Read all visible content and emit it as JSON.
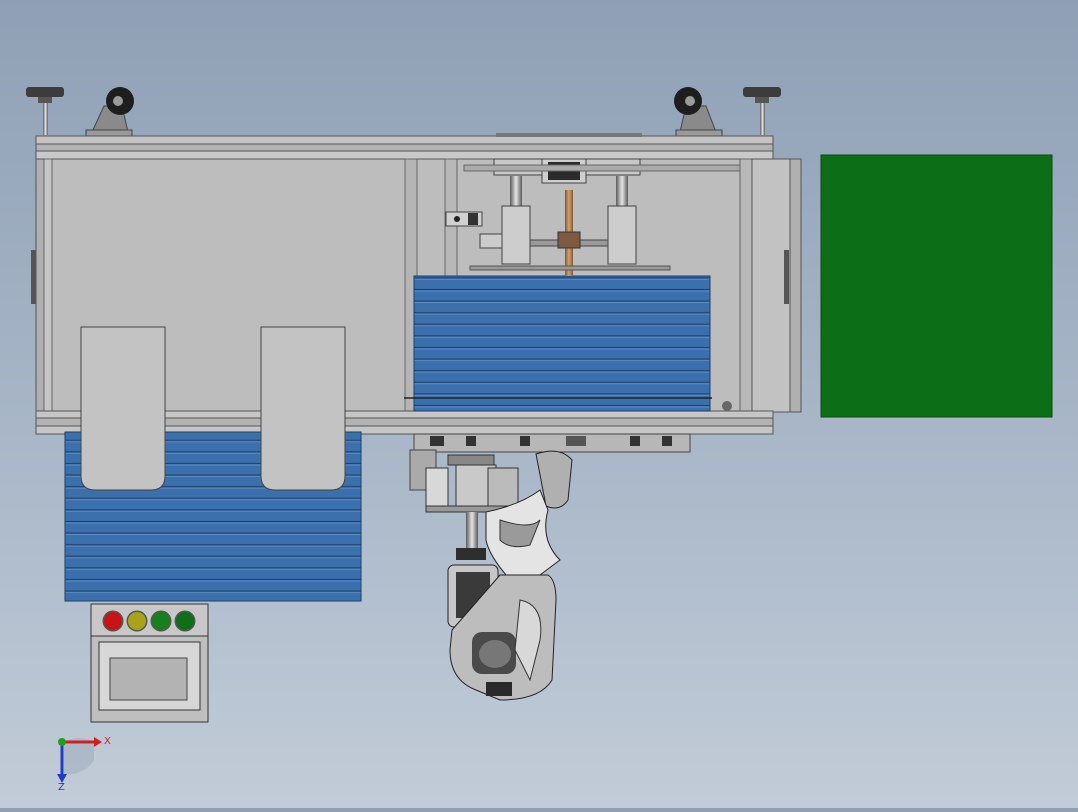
{
  "viewport": {
    "background_top": "#8fa0b6",
    "background_bottom": "#c2ccd8"
  },
  "model": {
    "frame_color": "#b9b9b9",
    "panel_color": "#bdbdbd",
    "louver_color": "#3b70ad",
    "green_block_color": "#0c6e17",
    "dark_part_color": "#3c3c3c"
  },
  "control_panel": {
    "lights": [
      {
        "name": "red-light",
        "color": "#c81414"
      },
      {
        "name": "yellow-light",
        "color": "#a8a318"
      },
      {
        "name": "green-light-1",
        "color": "#16801f"
      },
      {
        "name": "green-light-2",
        "color": "#0f6e18"
      }
    ],
    "screen_color": "#b3b3b3"
  },
  "axis_triad": {
    "x_label": "X",
    "z_label": "Z",
    "x_color": "#d21e1e",
    "y_color": "#1ea01e",
    "z_color": "#1e3cc8"
  }
}
